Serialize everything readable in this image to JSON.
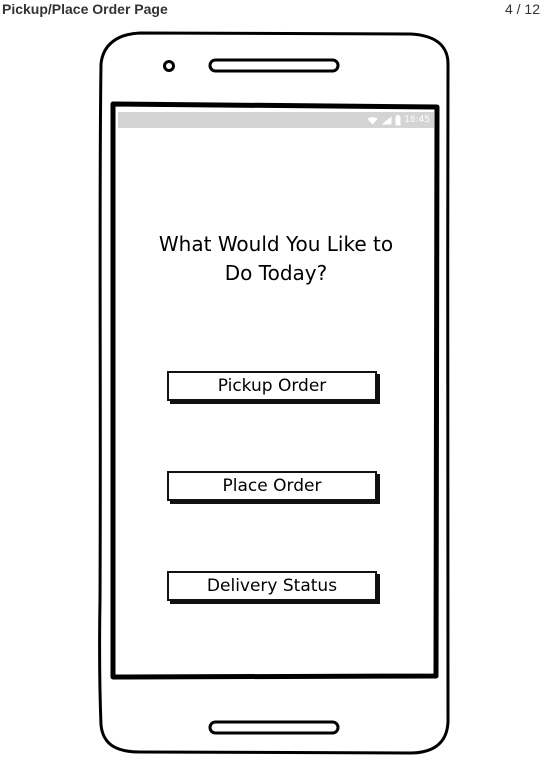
{
  "header": {
    "title": "Pickup/Place Order Page",
    "page_counter": "4 / 12"
  },
  "status_bar": {
    "time": "18:45",
    "icons": [
      "wifi-icon",
      "signal-icon",
      "battery-icon"
    ],
    "background": "#d4d4d4"
  },
  "screen": {
    "heading_line1": "What Would You Like to",
    "heading_line2": "Do Today?",
    "buttons": [
      {
        "label": "Pickup Order"
      },
      {
        "label": "Place Order"
      },
      {
        "label": "Delivery Status"
      }
    ]
  }
}
